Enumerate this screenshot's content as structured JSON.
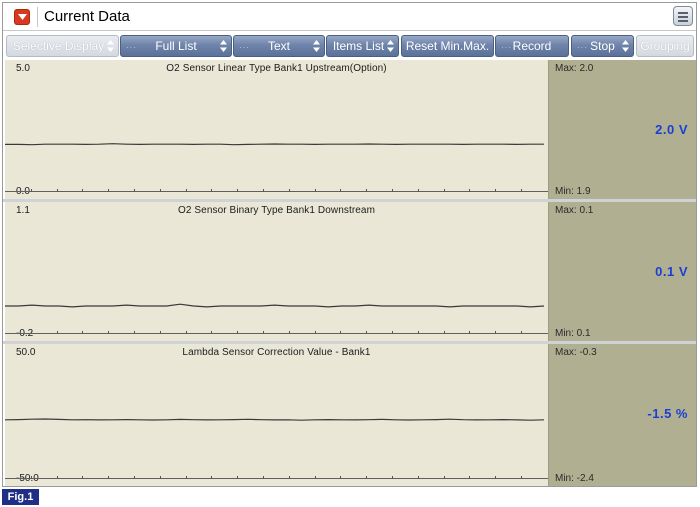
{
  "window": {
    "title": "Current Data"
  },
  "toolbar": {
    "buttons": [
      {
        "label": "Selective Display",
        "enabled": false,
        "dropdown": true
      },
      {
        "label": "Full List",
        "enabled": true,
        "dropdown": true
      },
      {
        "label": "Text",
        "enabled": true,
        "dropdown": true
      },
      {
        "label": "Items List",
        "enabled": true,
        "dropdown": true
      },
      {
        "label": "Reset Min.Max.",
        "enabled": true,
        "dropdown": false
      },
      {
        "label": "Record",
        "enabled": true,
        "dropdown": false
      },
      {
        "label": "Stop",
        "enabled": true,
        "dropdown": true
      },
      {
        "label": "Grouping",
        "enabled": false,
        "dropdown": false
      }
    ]
  },
  "panels": [
    {
      "title": "O2 Sensor Linear Type Bank1 Upstream(Option)",
      "scale_max": "5.0",
      "scale_min": "0.0",
      "max_label": "Max: 2.0",
      "min_label": "Min: 1.9",
      "value": "2.0 V",
      "y_range": [
        0.0,
        5.0
      ],
      "trace": [
        1.99,
        1.99,
        1.98,
        2.0,
        2.0,
        2.0,
        1.99,
        2.0,
        2.02,
        2.0,
        1.99,
        2.0,
        2.0,
        2.0,
        1.99,
        2.0,
        2.0,
        1.98,
        1.99,
        2.0,
        2.01,
        2.0,
        2.0,
        1.99,
        2.0,
        2.0,
        2.0,
        2.01,
        2.0,
        1.99,
        2.0,
        2.0,
        2.0,
        2.0,
        1.99,
        2.0,
        2.0,
        2.0,
        1.99,
        2.0,
        2.0
      ]
    },
    {
      "title": "O2 Sensor Binary Type Bank1 Downstream",
      "scale_max": "1.1",
      "scale_min": "-0.2",
      "max_label": "Max: 0.1",
      "min_label": "Min: 0.1",
      "value": "0.1 V",
      "y_range": [
        -0.2,
        1.1
      ],
      "trace": [
        0.1,
        0.1,
        0.11,
        0.1,
        0.1,
        0.09,
        0.1,
        0.1,
        0.1,
        0.11,
        0.1,
        0.1,
        0.1,
        0.12,
        0.1,
        0.09,
        0.1,
        0.1,
        0.1,
        0.1,
        0.11,
        0.1,
        0.1,
        0.1,
        0.09,
        0.1,
        0.1,
        0.11,
        0.1,
        0.1,
        0.1,
        0.1,
        0.1,
        0.09,
        0.1,
        0.1,
        0.1,
        0.1,
        0.1,
        0.09,
        0.1
      ]
    },
    {
      "title": "Lambda Sensor Correction Value - Bank1",
      "scale_max": "50.0",
      "scale_min": "-50.0",
      "max_label": "Max: -0.3",
      "min_label": "Min: -2.4",
      "value": "-1.5 %",
      "y_range": [
        -50.0,
        50.0
      ],
      "trace": [
        -1.5,
        -1.3,
        -1.0,
        -0.8,
        -1.2,
        -1.5,
        -1.4,
        -1.6,
        -1.5,
        -1.3,
        -1.5,
        -1.7,
        -1.5,
        -1.2,
        -1.4,
        -1.6,
        -1.5,
        -1.3,
        -1.1,
        -1.4,
        -1.6,
        -1.5,
        -1.8,
        -1.5,
        -1.3,
        -1.5,
        -1.6,
        -1.4,
        -1.2,
        -1.5,
        -1.7,
        -1.5,
        -1.3,
        -1.0,
        -1.4,
        -1.6,
        -1.5,
        -1.3,
        -1.6,
        -1.8,
        -1.5
      ]
    }
  ],
  "figure_label": "Fig.1",
  "colors": {
    "button_blue": "#6f84aa",
    "plot_bg": "#eae7d6",
    "side_bg": "#b1af91",
    "value_blue": "#1a3fd4",
    "menu_red": "#d9391f",
    "fig_navy": "#1f2f86"
  }
}
